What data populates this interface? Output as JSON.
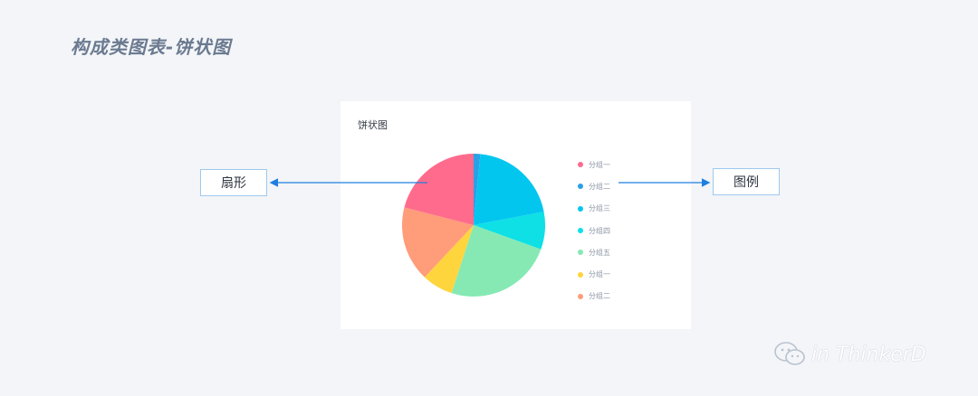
{
  "page_title": "构成类图表-饼状图",
  "card": {
    "title": "饼状图"
  },
  "callouts": {
    "sector": "扇形",
    "legend": "图例"
  },
  "watermark": {
    "text": "in ThinkerD",
    "icon": "wechat-icon"
  },
  "colors": {
    "background": "#f3f5f8",
    "arrow": "#1e7fe0"
  },
  "chart_data": {
    "type": "pie",
    "title": "饼状图",
    "legend_position": "right",
    "slices": [
      {
        "label": "分组二",
        "value": 1.5,
        "color": "#2aa0e6"
      },
      {
        "label": "分组三",
        "value": 20.5,
        "color": "#03c6ef"
      },
      {
        "label": "分组四",
        "value": 8.5,
        "color": "#0ee0e6"
      },
      {
        "label": "分组五",
        "value": 24.5,
        "color": "#86e9b4"
      },
      {
        "label": "分组一",
        "value": 7.0,
        "color": "#ffd53e"
      },
      {
        "label": "分组二",
        "value": 17.0,
        "color": "#ff9c7a"
      },
      {
        "label": "分组一",
        "value": 21.0,
        "color": "#ff6b8d"
      }
    ],
    "legend": [
      {
        "label": "分组一",
        "color": "#ff6b8d"
      },
      {
        "label": "分组二",
        "color": "#2aa0e6"
      },
      {
        "label": "分组三",
        "color": "#03c6ef"
      },
      {
        "label": "分组四",
        "color": "#0ee0e6"
      },
      {
        "label": "分组五",
        "color": "#86e9b4"
      },
      {
        "label": "分组一",
        "color": "#ffd53e"
      },
      {
        "label": "分组二",
        "color": "#ff9c7a"
      }
    ]
  }
}
